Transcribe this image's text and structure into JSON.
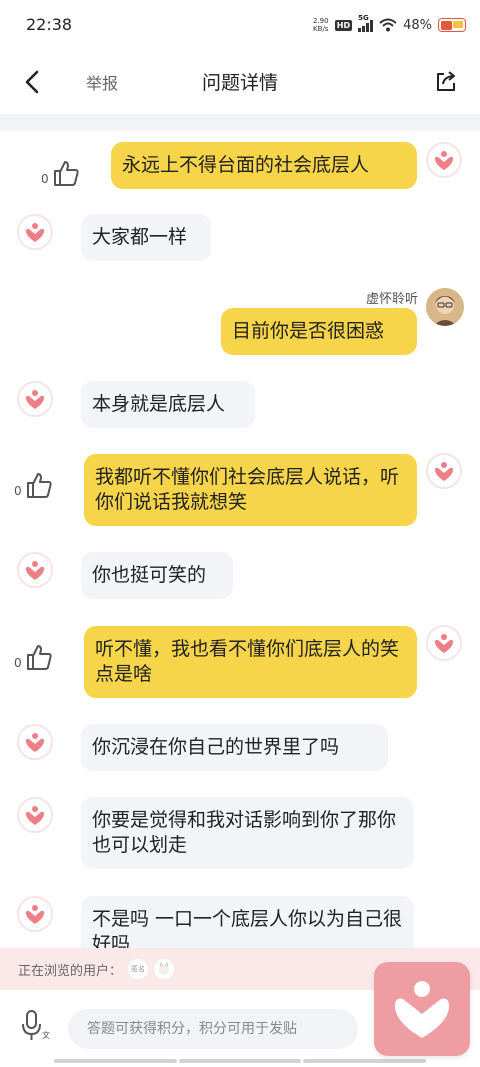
{
  "status_bar": {
    "time": "22:38",
    "net_speed": "2.90",
    "net_unit": "KB/s",
    "hd": "HD",
    "network": "5G",
    "battery": "48%"
  },
  "nav": {
    "report": "举报",
    "title": "问题详情"
  },
  "user_name": "虚怀聆听",
  "messages": [
    {
      "text": "永远上不得台面的社会底层人",
      "likes": "0"
    },
    {
      "text": "大家都一样"
    },
    {
      "text": "目前你是否很困惑"
    },
    {
      "text": "本身就是底层人"
    },
    {
      "text": "我都听不懂你们社会底层人说话，听你们说话我就想笑",
      "likes": "0"
    },
    {
      "text": "你也挺可笑的"
    },
    {
      "text": "听不懂，我也看不懂你们底层人的笑点是啥",
      "likes": "0"
    },
    {
      "text": "你沉浸在你自己的世界里了吗"
    },
    {
      "text": "你要是觉得和我对话影响到你了那你也可以划走"
    },
    {
      "text": "不是吗 一口一个底层人你以为自己很好吗"
    }
  ],
  "browsing": {
    "label": "正在浏览的用户：",
    "anon_label": "匿名"
  },
  "input": {
    "placeholder": "答题可获得积分，积分可用于发贴"
  },
  "colors": {
    "bubble_me": "#f7d54a",
    "bubble_them": "#f3f4f7",
    "accent_pink": "#ee9ea3"
  }
}
